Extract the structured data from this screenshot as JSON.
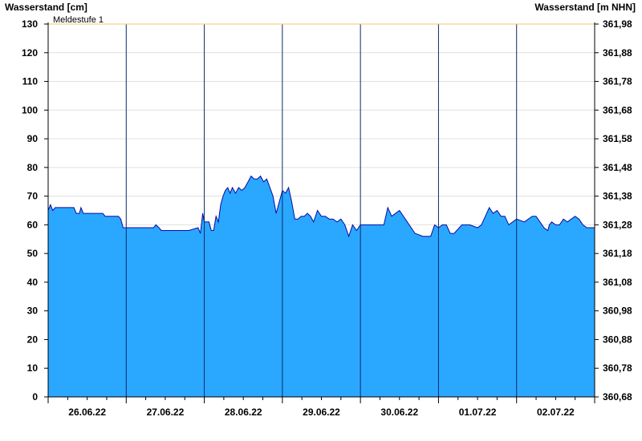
{
  "chart_data": {
    "type": "area",
    "ylabel_left": "Wasserstand [cm]",
    "ylabel_right": "Wasserstand [m NHN]",
    "ylim": [
      0,
      130
    ],
    "yticks_left": [
      "0",
      "10",
      "20",
      "30",
      "40",
      "50",
      "60",
      "70",
      "80",
      "90",
      "100",
      "110",
      "120",
      "130"
    ],
    "yticks_right": [
      "360,68",
      "360,78",
      "360,88",
      "360,98",
      "361,08",
      "361,18",
      "361,28",
      "361,38",
      "361,48",
      "361,58",
      "361,68",
      "361,78",
      "361,88",
      "361,98"
    ],
    "xlim": [
      0,
      7
    ],
    "xticks": [
      "26.06.22",
      "27.06.22",
      "28.06.22",
      "29.06.22",
      "30.06.22",
      "01.07.22",
      "02.07.22"
    ],
    "threshold": {
      "label": "Meldestufe 1",
      "value": 130,
      "color": "#f5c96b"
    },
    "colors": {
      "fill": "#2aa8ff",
      "line": "#0a0aa0",
      "grid": "#e0e0e0"
    },
    "x_unit": "days since 26.06.22 00:00",
    "series": [
      {
        "x": [
          0.0,
          0.03,
          0.06,
          0.09,
          0.12,
          0.33,
          0.36,
          0.4,
          0.42,
          0.45,
          0.48,
          0.7,
          0.73,
          0.9,
          0.93,
          0.96,
          1.2,
          1.35,
          1.38,
          1.42,
          1.45,
          1.55,
          1.6,
          1.65,
          1.8,
          1.92,
          1.95,
          1.98,
          2.0,
          2.03,
          2.06,
          2.09,
          2.12,
          2.15,
          2.18,
          2.21,
          2.24,
          2.27,
          2.3,
          2.33,
          2.36,
          2.4,
          2.44,
          2.48,
          2.52,
          2.56,
          2.6,
          2.64,
          2.68,
          2.72,
          2.76,
          2.8,
          2.84,
          2.88,
          2.92,
          2.96,
          3.0,
          3.04,
          3.08,
          3.12,
          3.16,
          3.2,
          3.24,
          3.28,
          3.32,
          3.36,
          3.4,
          3.45,
          3.5,
          3.55,
          3.6,
          3.65,
          3.7,
          3.75,
          3.8,
          3.85,
          3.9,
          3.95,
          4.0,
          4.05,
          4.1,
          4.2,
          4.3,
          4.35,
          4.4,
          4.5,
          4.6,
          4.7,
          4.8,
          4.9,
          4.95,
          5.0,
          5.05,
          5.1,
          5.15,
          5.2,
          5.3,
          5.4,
          5.5,
          5.55,
          5.6,
          5.65,
          5.7,
          5.75,
          5.8,
          5.85,
          5.9,
          6.0,
          6.1,
          6.2,
          6.25,
          6.3,
          6.35,
          6.4,
          6.42,
          6.45,
          6.5,
          6.55,
          6.6,
          6.65,
          6.7,
          6.75,
          6.8,
          6.85,
          6.9,
          6.95,
          7.0
        ],
        "y": [
          65,
          67,
          65,
          66,
          66,
          66,
          64,
          64,
          66,
          64,
          64,
          64,
          63,
          63,
          62,
          59,
          59,
          59,
          60,
          59,
          58,
          58,
          58,
          58,
          58,
          59,
          57,
          64,
          61,
          61,
          61,
          58,
          58,
          63,
          61,
          67,
          70,
          72,
          73,
          71,
          73,
          71,
          73,
          72,
          73,
          75,
          77,
          76,
          76,
          77,
          75,
          76,
          73,
          70,
          64,
          68,
          72,
          71,
          73,
          68,
          62,
          62,
          63,
          63,
          64,
          63,
          61,
          65,
          63,
          63,
          62,
          62,
          61,
          62,
          60,
          56,
          60,
          58,
          60,
          60,
          60,
          60,
          60,
          66,
          63,
          65,
          61,
          57,
          56,
          56,
          60,
          59,
          60,
          60,
          57,
          57,
          60,
          60,
          59,
          60,
          63,
          66,
          64,
          65,
          63,
          63,
          60,
          62,
          61,
          63,
          63,
          61,
          59,
          58,
          60,
          61,
          60,
          60,
          62,
          61,
          62,
          63,
          62,
          60,
          59,
          59,
          59
        ]
      }
    ]
  }
}
